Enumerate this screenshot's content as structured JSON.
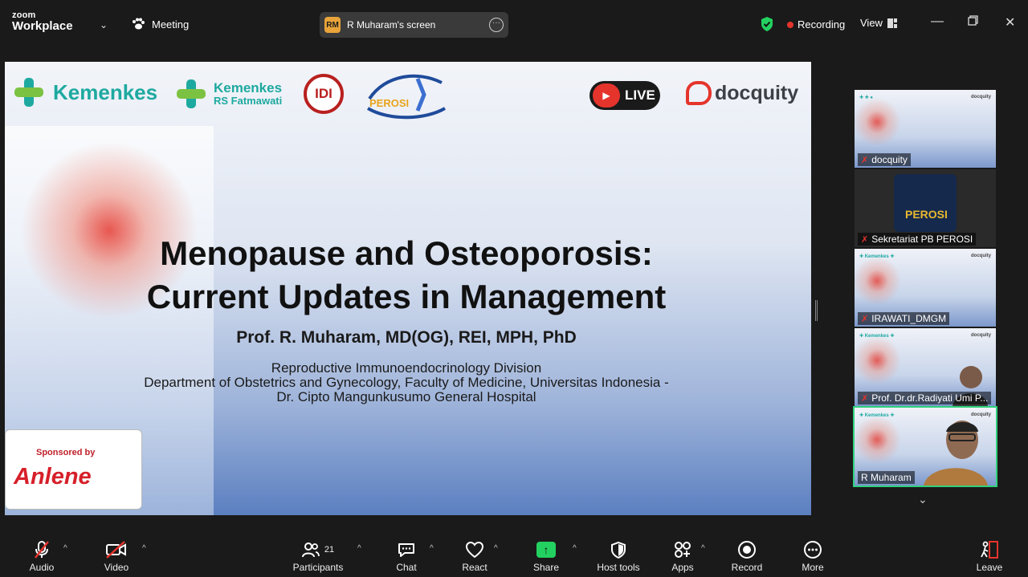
{
  "app": {
    "logo_line1": "zoom",
    "logo_line2": "Workplace",
    "meeting_label": "Meeting"
  },
  "screen_share": {
    "initials": "RM",
    "title": "R Muharam's screen"
  },
  "status": {
    "recording_label": "Recording",
    "view_label": "View"
  },
  "slide": {
    "logos": {
      "kemenkes": "Kemenkes",
      "kemenkes2_line1": "Kemenkes",
      "kemenkes2_line2": "RS Fatmawati",
      "idi": "IDI",
      "perosi": "PEROSI",
      "live": "LIVE",
      "docquity": "docquity"
    },
    "title_line1": "Menopause and Osteoporosis:",
    "title_line2": "Current Updates in Management",
    "author": "Prof. R. Muharam, MD(OG), REI, MPH, PhD",
    "affil_line1": "Reproductive Immunoendocrinology Division",
    "affil_line2": "Department of Obstetrics and Gynecology, Faculty of Medicine, Universitas Indonesia -",
    "affil_line3": "Dr. Cipto Mangunkusumo General Hospital",
    "sponsor_label": "Sponsored by",
    "sponsor_brand": "Anlene"
  },
  "participants_panel": [
    {
      "name": "docquity"
    },
    {
      "name": "Sekretariat PB PEROSI"
    },
    {
      "name": "IRAWATI_DMGM"
    },
    {
      "name": "Prof. Dr.dr.Radiyati Umi P..."
    },
    {
      "name": "R Muharam"
    }
  ],
  "toolbar": {
    "audio": "Audio",
    "video": "Video",
    "participants": "Participants",
    "participants_count": "21",
    "chat": "Chat",
    "react": "React",
    "share": "Share",
    "host_tools": "Host tools",
    "apps": "Apps",
    "record": "Record",
    "more": "More",
    "leave": "Leave"
  },
  "colors": {
    "accent_green": "#23d160",
    "record_red": "#e5342c",
    "kemenkes_teal": "#1ea9a0"
  }
}
